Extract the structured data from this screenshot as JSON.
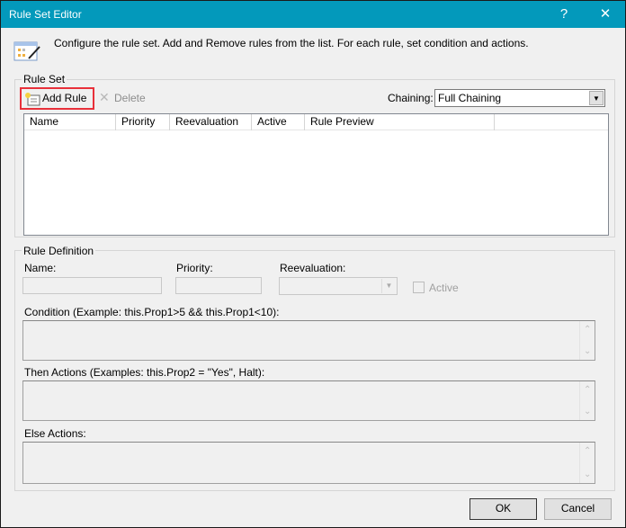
{
  "window": {
    "title": "Rule Set Editor",
    "help_label": "?",
    "close_label": "✕"
  },
  "description": "Configure the rule set. Add and Remove rules from the list. For each rule, set condition and actions.",
  "rule_set": {
    "label": "Rule Set",
    "add_rule": "Add Rule",
    "delete": "Delete",
    "chaining_label": "Chaining:",
    "chaining_value": "Full Chaining",
    "columns": [
      "Name",
      "Priority",
      "Reevaluation",
      "Active",
      "Rule Preview",
      ""
    ]
  },
  "rule_definition": {
    "label": "Rule Definition",
    "name_label": "Name:",
    "priority_label": "Priority:",
    "reevaluation_label": "Reevaluation:",
    "active_label": "Active",
    "condition_label": "Condition (Example: this.Prop1>5 && this.Prop1<10):",
    "then_label": "Then Actions (Examples: this.Prop2 = \"Yes\", Halt):",
    "else_label": "Else Actions:"
  },
  "footer": {
    "ok": "OK",
    "cancel": "Cancel"
  },
  "colors": {
    "titlebar": "#0399bb",
    "highlight": "#e8303a"
  }
}
